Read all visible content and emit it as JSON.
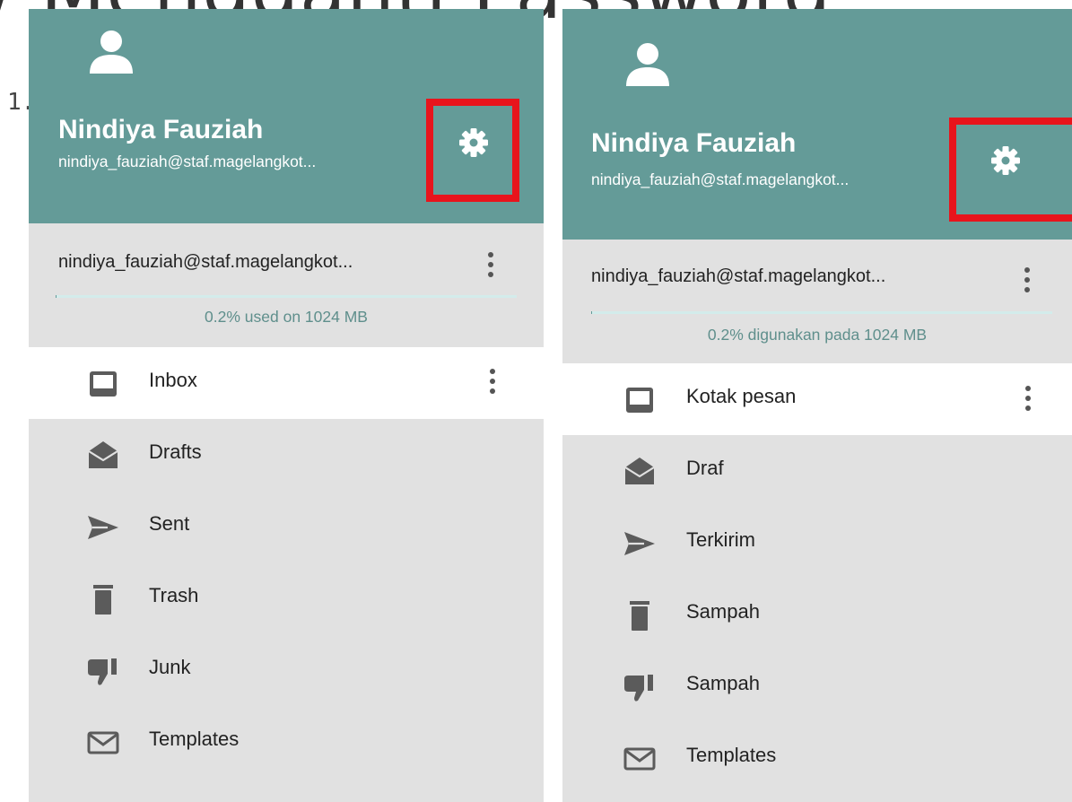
{
  "background": {
    "title": "/ Mengganti Password",
    "step": "1.",
    "step_fragment": "r"
  },
  "panels": [
    {
      "user_name": "Nindiya Fauziah",
      "user_email": "nindiya_fauziah@staf.magelangkot...",
      "account_email": "nindiya_fauziah@staf.magelangkot...",
      "quota_percent": 0.2,
      "quota_text": "0.2% used on 1024 MB",
      "folders": [
        {
          "label": "Inbox",
          "icon": "inbox-icon"
        },
        {
          "label": "Drafts",
          "icon": "drafts-icon"
        },
        {
          "label": "Sent",
          "icon": "sent-icon"
        },
        {
          "label": "Trash",
          "icon": "trash-icon"
        },
        {
          "label": "Junk",
          "icon": "junk-icon"
        },
        {
          "label": "Templates",
          "icon": "templates-icon"
        }
      ]
    },
    {
      "user_name": "Nindiya Fauziah",
      "user_email": "nindiya_fauziah@staf.magelangkot...",
      "account_email": "nindiya_fauziah@staf.magelangkot...",
      "quota_percent": 0.2,
      "quota_text": "0.2% digunakan pada 1024 MB",
      "folders": [
        {
          "label": "Kotak pesan",
          "icon": "inbox-icon"
        },
        {
          "label": "Draf",
          "icon": "drafts-icon"
        },
        {
          "label": "Terkirim",
          "icon": "sent-icon"
        },
        {
          "label": "Sampah",
          "icon": "trash-icon"
        },
        {
          "label": "Sampah",
          "icon": "junk-icon"
        },
        {
          "label": "Templates",
          "icon": "templates-icon"
        }
      ]
    }
  ],
  "colors": {
    "header": "#649b98",
    "sidebar": "#e1e1e1",
    "highlight": "#e8141c",
    "active_row": "#ffffff"
  }
}
